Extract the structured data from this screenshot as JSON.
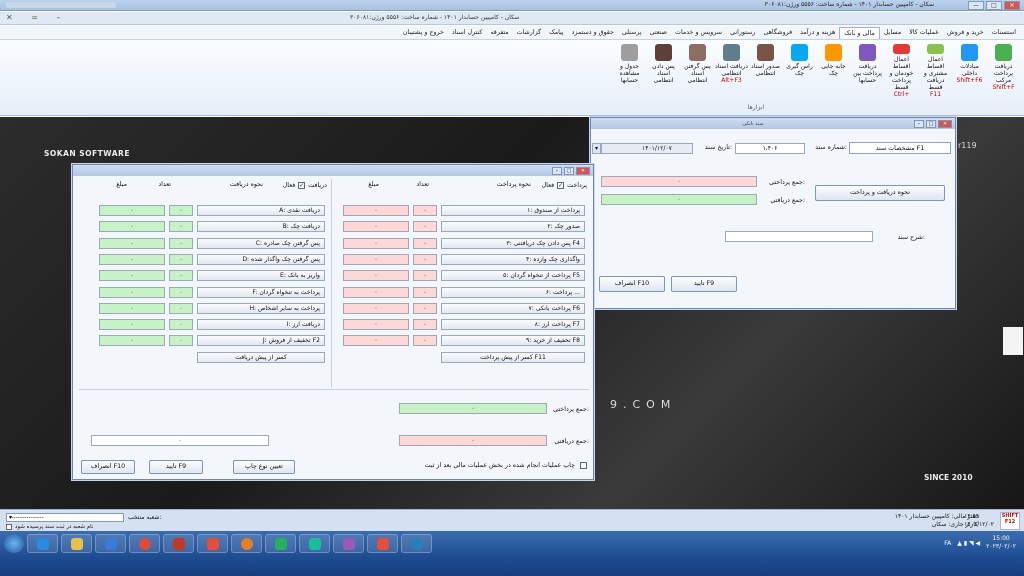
{
  "window": {
    "title": "سکان - کامپیین حسابدار ۱۴۰۱ - شماره ساخت: ۵۵۵۶  ورژن:۳۰۶۰۸۱",
    "subtitle": "سکان - کامپیین حسابدار ۱۴۰۱ - شماره ساخت: ۵۵۵۶  ورژن:۳۰۶۰۸۱"
  },
  "menu": [
    "استسنات",
    "خرید و فروش",
    "عملیات کالا",
    "مسایل",
    "مالی و بانک",
    "هزینه و درآمد",
    "فروشگاهی",
    "رستورانی",
    "سرویس و خدمات",
    "صنعتی",
    "پرسنلی",
    "حقوق و دستمزد",
    "پیامک",
    "گزارشات",
    "متفرقه",
    "کنترل اسناد",
    "خروج و پشتیبان"
  ],
  "menu_active": "مالی و بانک",
  "ribbon": {
    "caption": "ابزارها",
    "buttons": [
      {
        "label": "دریافت پرداخت مرکب",
        "hot": "Shift+F"
      },
      {
        "label": "مبادلات داخلی",
        "hot": "Shift+F6"
      },
      {
        "label": "اعمال اقساط مشتری و دریافت قسط",
        "hot": "F11"
      },
      {
        "label": "اعمال اقساط خودمان و پرداخت قسط",
        "hot": "Ctrl+"
      },
      {
        "label": "دریافت پرداخت بین حسابها",
        "hot": ""
      },
      {
        "label": "جابه جایی چک",
        "hot": ""
      },
      {
        "label": "راس گیری چک",
        "hot": ""
      },
      {
        "label": "صدور اسناد انتظامی",
        "hot": ""
      },
      {
        "label": "دریافت اسناد انتظامی",
        "hot": "Alt+F3"
      },
      {
        "label": "پس گرفتن اسناد انتظامی",
        "hot": ""
      },
      {
        "label": "پس دادن اسناد انتظامی",
        "hot": ""
      },
      {
        "label": "جدول و مشاهده حسابها",
        "hot": ""
      }
    ]
  },
  "desktop": {
    "brand_left": "SOKAN SOFTWARE",
    "brand_right": "SINCE 2010",
    "brand_mid": "9.COM",
    "brand_corner": "r119"
  },
  "doc_dialog": {
    "title": "سند بانکی",
    "tab": "مشخصات سند F1",
    "doc_number_label": "شماره سند:",
    "doc_number": "۱،۴۰۶",
    "doc_date_label": "تاریخ سند:",
    "doc_date": "۱۴۰۱/۱۲/۰۷",
    "pay_total_label": "جمع پرداختی:",
    "pay_total": "۰",
    "recv_total_label": "جمع دریافتی:",
    "recv_total": "۰",
    "method_button": "نحوه دریافت و پرداخت",
    "desc_label": "شرح سند:",
    "desc_value": "",
    "ok_button": "تایید F9",
    "cancel_button": "انصراف F10"
  },
  "pay_dialog": {
    "title": "",
    "pay_active_label": "پرداخت",
    "pay_active": "فعال",
    "recv_active_label": "دریافت",
    "recv_active": "فعال",
    "method_pay_header": "نحوه پرداخت",
    "method_recv_header": "نحوه دریافت",
    "count_header": "تعداد",
    "amount_header": "مبلغ",
    "pay_rows": [
      {
        "label": "۱: پرداخت از صندوق",
        "count": "۰",
        "amount": "۰"
      },
      {
        "label": "۲: صدور چک",
        "count": "۰",
        "amount": "۰"
      },
      {
        "label": "۳: پس دادن چک دریافتنی F4",
        "count": "۰",
        "amount": "۰"
      },
      {
        "label": "۴: واگذاری چک وارده",
        "count": "۰",
        "amount": "۰"
      },
      {
        "label": "۵: پرداخت از تنخواه گردان F5",
        "count": "۰",
        "amount": "۰"
      },
      {
        "label": "۶: پرداخت ...",
        "count": "۰",
        "amount": "۰"
      },
      {
        "label": "۷: پرداخت بانکی F6",
        "count": "۰",
        "amount": "۰"
      },
      {
        "label": "۸: پرداخت ارز F7",
        "count": "۰",
        "amount": "۰"
      },
      {
        "label": "۹: تخفیف از خرید F8",
        "count": "۰",
        "amount": "۰"
      }
    ],
    "pay_extra": "کسر از پیش پرداخت F11",
    "recv_rows": [
      {
        "label": "A: دریافت نقدی",
        "count": "۰",
        "amount": "۰"
      },
      {
        "label": "B: دریافت چک",
        "count": "۰",
        "amount": "۰"
      },
      {
        "label": "C: پس گرفتن چک صادره",
        "count": "۰",
        "amount": "۰"
      },
      {
        "label": "D: پس گرفتن چک واگذار شده",
        "count": "۰",
        "amount": "۰"
      },
      {
        "label": "E: واریز به بانک",
        "count": "۰",
        "amount": "۰"
      },
      {
        "label": "F: پرداخت به تنخواه گردان",
        "count": "۰",
        "amount": "۰"
      },
      {
        "label": "H: پرداخت به سایر اشخاص",
        "count": "۰",
        "amount": "۰"
      },
      {
        "label": "I: دریافت ارز",
        "count": "۰",
        "amount": "۰"
      },
      {
        "label": "J: تخفیف از فروش F2",
        "count": "۰",
        "amount": "۰"
      }
    ],
    "recv_extra": "کسر از پیش دریافت",
    "pay_total_label": "جمع پرداختی:",
    "pay_total": "۰",
    "recv_total_label": "جمع دریافتی:",
    "recv_total": "۰",
    "left_total": "۰",
    "print_check": "چاپ عملیات انجام شده در بخش عملیات مالی بعد از ثبت",
    "print_type": "تعیین نوع چاپ",
    "ok_button": "تایید F9",
    "cancel_button": "انصراف F10"
  },
  "status": {
    "selected_branch_label": "شعبه منتخب:",
    "selected_branch": "----------------",
    "branch_check": "نام شعبه در ثبت سند پرسیده شود",
    "fiscal_label": "دفتر مالی: کامپیین حسابدار ۱۴۰۱",
    "user_label": "کاربر جاری: سکان",
    "time": "۱۴:۵۹",
    "date": "۱۴۰۱/۱۲/۰۲",
    "shift": "SHIFT F12"
  },
  "taskbar": {
    "clock_time": "15:00",
    "clock_date": "۲۰۲۳/۰۲/۰۲",
    "lang": "FA"
  },
  "colors": {
    "accent": "#1d4c91",
    "pink": "#ffd7d7",
    "green": "#c6f2c6"
  }
}
